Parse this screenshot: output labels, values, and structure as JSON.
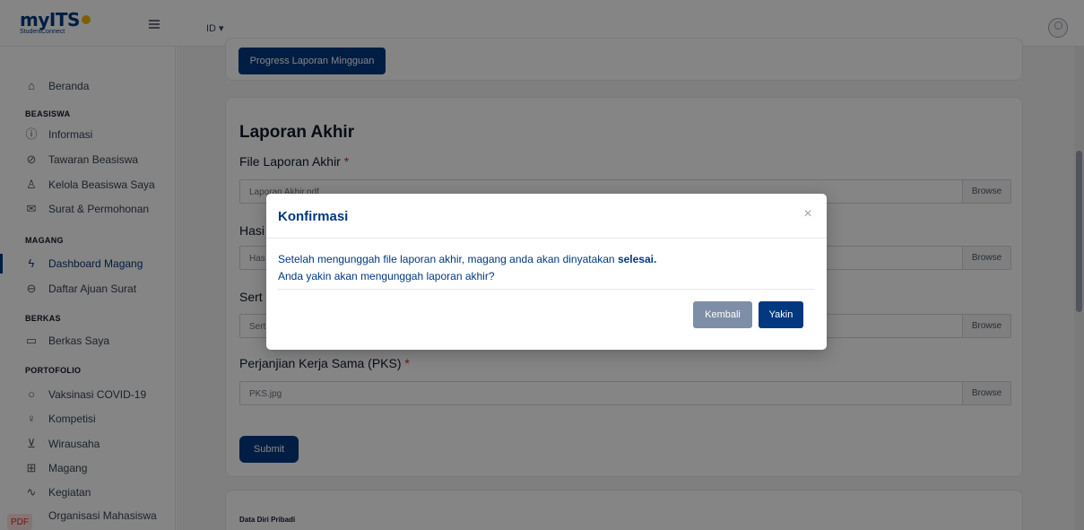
{
  "header": {
    "logo_text": "myITS",
    "logo_subtext": "StudentConnect",
    "language": "ID ▾"
  },
  "sidebar": {
    "top_items": [
      {
        "label": "Beranda",
        "icon": "home-icon"
      }
    ],
    "sections": [
      {
        "title": "BEASISWA",
        "items": [
          {
            "label": "Informasi",
            "icon": "info-icon"
          },
          {
            "label": "Tawaran Beasiswa",
            "icon": "check-circle-icon"
          },
          {
            "label": "Kelola Beasiswa Saya",
            "icon": "user-icon"
          },
          {
            "label": "Surat & Permohonan",
            "icon": "mail-icon"
          }
        ]
      },
      {
        "title": "MAGANG",
        "items": [
          {
            "label": "Dashboard Magang",
            "icon": "lightning-icon",
            "active": true
          },
          {
            "label": "Daftar Ajuan Surat",
            "icon": "inbox-icon"
          }
        ]
      },
      {
        "title": "BERKAS",
        "items": [
          {
            "label": "Berkas Saya",
            "icon": "folder-icon"
          }
        ]
      },
      {
        "title": "PORTOFOLIO",
        "items": [
          {
            "label": "Vaksinasi COVID-19",
            "icon": "vaccine-icon"
          },
          {
            "label": "Kompetisi",
            "icon": "trophy-icon"
          },
          {
            "label": "Wirausaha",
            "icon": "cart-icon"
          },
          {
            "label": "Magang",
            "icon": "building-icon"
          },
          {
            "label": "Kegiatan",
            "icon": "activity-icon"
          },
          {
            "label": "Organisasi Mahasiswa",
            "icon": "people-icon"
          }
        ]
      }
    ]
  },
  "main": {
    "progress_button": "Progress Laporan Mingguan",
    "form_title": "Laporan Akhir",
    "fields": [
      {
        "label": "File Laporan Akhir",
        "value": "Laporan Akhir.pdf",
        "browse": "Browse"
      },
      {
        "label": "Hasi",
        "value": "Has",
        "browse": "Browse"
      },
      {
        "label": "Sert",
        "value": "Sert",
        "browse": "Browse"
      },
      {
        "label": "Perjanjian Kerja Sama (PKS)",
        "value": "PKS.jpg",
        "browse": "Browse"
      }
    ],
    "required_mark": "*",
    "submit_label": "Submit",
    "next_section_title": "Data Diri Pribadi"
  },
  "modal": {
    "title": "Konfirmasi",
    "close_symbol": "×",
    "message_line1_prefix": "Setelah mengunggah file laporan akhir, magang anda akan dinyatakan ",
    "message_line1_bold": "selesai.",
    "message_line2": "Anda yakin akan mengunggah laporan akhir?",
    "back_label": "Kembali",
    "confirm_label": "Yakin"
  },
  "corner_badge": "PDF"
}
